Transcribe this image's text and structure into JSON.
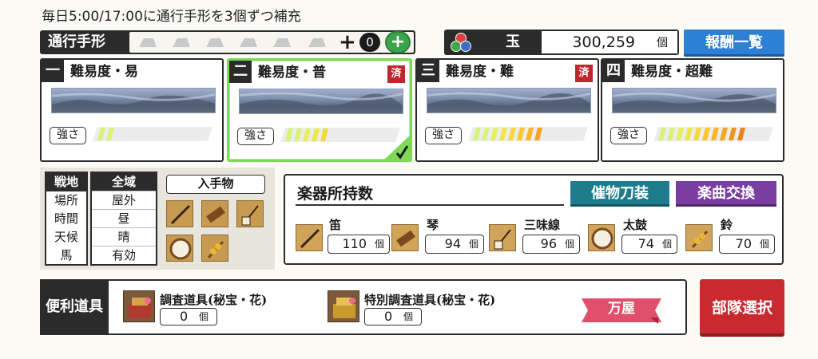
{
  "banner": "毎日5:00/17:00に通行手形を3個ずつ補充",
  "pass": {
    "label": "通行手形",
    "count": "0",
    "plus": "+",
    "slots": 6
  },
  "gem": {
    "label": "玉",
    "value": "300,259",
    "unit": "個"
  },
  "reward_button": "報酬一覧",
  "cards": [
    {
      "num": "一",
      "title": "難易度・易",
      "cleared_label": "",
      "strength_label": "強さ",
      "strength_level": 2,
      "selected": false
    },
    {
      "num": "二",
      "title": "難易度・普",
      "cleared_label": "済",
      "strength_label": "強さ",
      "strength_level": 5,
      "selected": true
    },
    {
      "num": "三",
      "title": "難易度・難",
      "cleared_label": "済",
      "strength_label": "強さ",
      "strength_level": 8,
      "selected": false
    },
    {
      "num": "四",
      "title": "難易度・超難",
      "cleared_label": "",
      "strength_label": "強さ",
      "strength_level": 10,
      "selected": false
    }
  ],
  "conditions": {
    "left": [
      "戦地",
      "場所",
      "時間",
      "天候",
      "馬"
    ],
    "right": [
      "全域",
      "屋外",
      "昼",
      "晴",
      "有効"
    ]
  },
  "drops_header": "入手物",
  "instruments": {
    "title": "楽器所持数",
    "event_button": "催物刀装",
    "exchange_button": "楽曲交換",
    "items": [
      {
        "name": "笛",
        "count": "110",
        "unit": "個",
        "icon": "flute-icon"
      },
      {
        "name": "琴",
        "count": "94",
        "unit": "個",
        "icon": "koto-icon"
      },
      {
        "name": "三味線",
        "count": "96",
        "unit": "個",
        "icon": "shamisen-icon"
      },
      {
        "name": "太鼓",
        "count": "74",
        "unit": "個",
        "icon": "drum-icon"
      },
      {
        "name": "鈴",
        "count": "70",
        "unit": "個",
        "icon": "bell-icon"
      }
    ]
  },
  "tools": {
    "label": "便利道具",
    "items": [
      {
        "name": "調査道具(秘宝・花)",
        "count": "0",
        "unit": "個"
      },
      {
        "name": "特別調査道具(秘宝・花)",
        "count": "0",
        "unit": "個"
      }
    ],
    "shop_button": "万屋"
  },
  "squad_button": "部隊選択",
  "colors": {
    "accent_blue": "#2e7fd6",
    "teal": "#1f7c8c",
    "purple": "#7a3da0",
    "red": "#c82a2f",
    "selected_green": "#7ed957"
  }
}
